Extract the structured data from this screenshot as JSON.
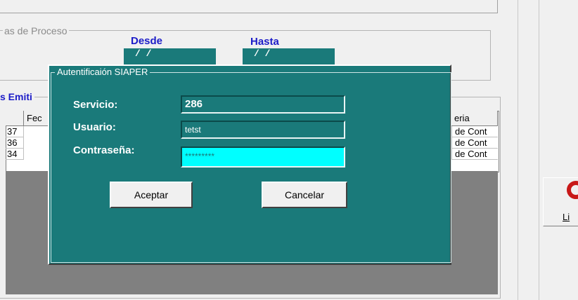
{
  "process_group": {
    "title": "as de Proceso",
    "desde_label": "Desde",
    "desde_value": "/ /",
    "hasta_label": "Hasta",
    "hasta_value": "/ /"
  },
  "emitted_group": {
    "title": "s Emiti",
    "columns": {
      "left": "",
      "fec": "Fec",
      "right": "eria"
    },
    "rows": [
      {
        "id": "37",
        "desc": "de Cont"
      },
      {
        "id": "36",
        "desc": "de Cont"
      },
      {
        "id": "34",
        "desc": "de Cont"
      }
    ]
  },
  "side": {
    "label": "Li",
    "icon": "red-circle-icon"
  },
  "dialog": {
    "title": "Autentificaión SIAPER",
    "servicio_label": "Servicio:",
    "servicio_value": "286",
    "usuario_label": "Usuario:",
    "usuario_value": "tetst",
    "contrasena_label": "Contraseña:",
    "contrasena_value": "*********",
    "accept_label": "Aceptar",
    "cancel_label": "Cancelar"
  },
  "colors": {
    "dialog_bg": "#1a7a7a",
    "active_field": "#00ffff",
    "label_blue": "#1c1cc8"
  }
}
